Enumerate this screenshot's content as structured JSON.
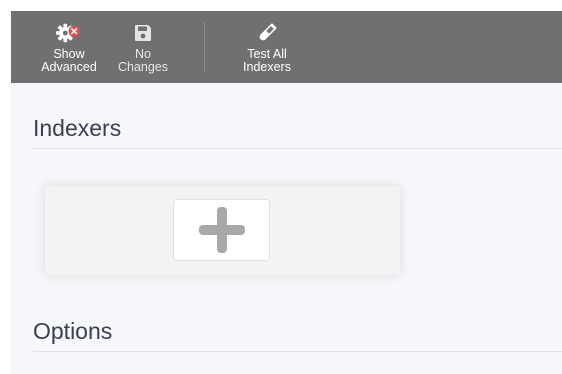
{
  "toolbar": {
    "show_advanced": {
      "label": "Show\nAdvanced",
      "icon": "gear-icon"
    },
    "no_changes": {
      "label": "No\nChanges",
      "icon": "save-icon"
    },
    "test_all_indexers": {
      "label": "Test All\nIndexers",
      "icon": "test-tube-icon"
    }
  },
  "sections": {
    "indexers": {
      "title": "Indexers"
    },
    "options": {
      "title": "Options"
    }
  },
  "add_indexer": {
    "icon": "plus-icon"
  },
  "colors": {
    "toolbar_bg": "#707070",
    "page_bg": "#f5f7fa",
    "advanced_badge": "#e05252",
    "plus_gray": "#a8a8a8"
  }
}
